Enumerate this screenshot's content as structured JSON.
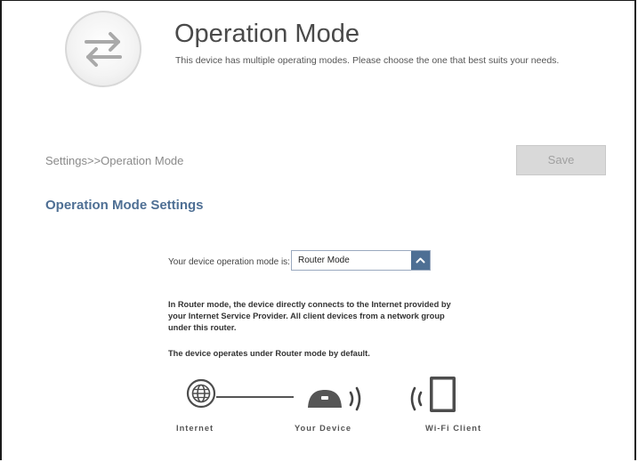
{
  "header": {
    "title": "Operation Mode",
    "description": "This device has multiple operating modes. Please choose the one that best suits your needs.",
    "icon": "swap-arrows-icon"
  },
  "breadcrumb": "Settings>>Operation Mode",
  "toolbar": {
    "save_label": "Save"
  },
  "section": {
    "title": "Operation Mode Settings",
    "mode_label": "Your device operation mode is:",
    "mode_value": "Router Mode",
    "description_lines": [
      "In Router mode, the device directly connects to the Internet provided by",
      "your Internet Service Provider. All client devices from a network group",
      "under this router."
    ],
    "default_note": "The device operates under Router mode by default."
  },
  "diagram": {
    "labels": {
      "internet": "Internet",
      "device": "Your Device",
      "client": "Wi-Fi Client"
    }
  },
  "colors": {
    "accent": "#4e6f94",
    "save_bg": "#d9d9d9",
    "save_text": "#a0a0a0"
  }
}
